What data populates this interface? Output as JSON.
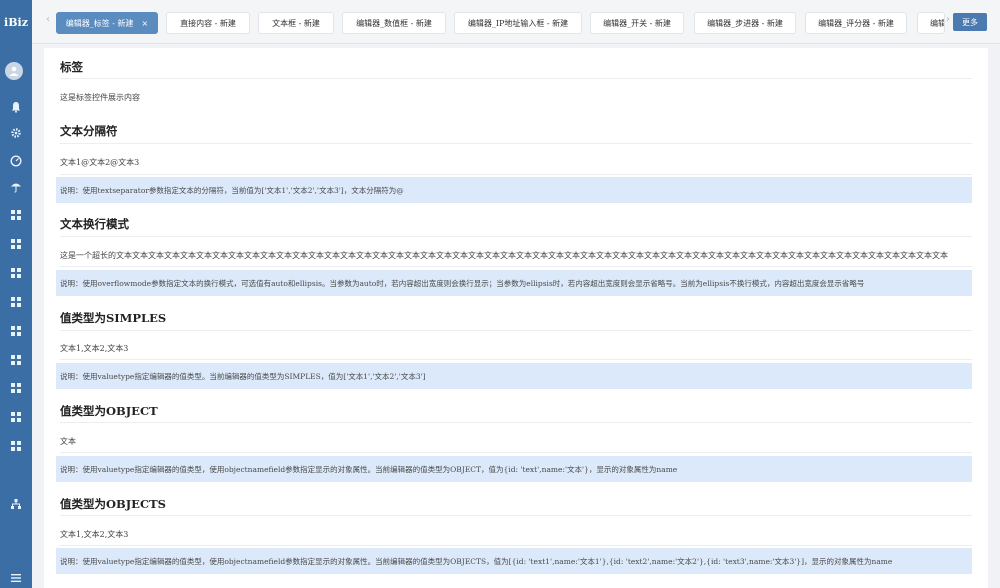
{
  "app": {
    "logo": "iBiz"
  },
  "sidebar": {
    "icons": [
      "bell-icon",
      "gear-icon",
      "dashboard-icon",
      "umbrella-icon",
      "grid-icon",
      "grid-icon",
      "grid-icon",
      "grid-icon",
      "grid-icon",
      "grid-icon",
      "grid-icon",
      "grid-icon",
      "grid-icon",
      "org-icon",
      "menu-icon"
    ]
  },
  "tabs": [
    {
      "label": "编辑器_标签 - 新建",
      "active": true
    },
    {
      "label": "直接内容 - 新建"
    },
    {
      "label": "文本框 - 新建"
    },
    {
      "label": "编辑器_数值框 - 新建"
    },
    {
      "label": "编辑器_IP地址输入框 - 新建"
    },
    {
      "label": "编辑器_开关 - 新建"
    },
    {
      "label": "编辑器_步进器 - 新建"
    },
    {
      "label": "编辑器_评分器 - 新建"
    },
    {
      "label": "编辑"
    }
  ],
  "tabbar": {
    "close_glyph": "×",
    "more_label": "更多"
  },
  "sections": [
    {
      "title": "标签",
      "value": "这是标签控件展示内容",
      "note": ""
    },
    {
      "title": "文本分隔符",
      "value": "文本1@文本2@文本3",
      "note": "说明：使用textseparator参数指定文本的分隔符，当前值为['文本1','文本2','文本3']，文本分隔符为@"
    },
    {
      "title": "文本换行模式",
      "value": "这是一个超长的文本文本文本文本文本文本文本文本文本文本文本文本文本文本文本文本文本文本文本文本文本文本文本文本文本文本文本文本文本文本文本文本文本文本文本文本文本文本文本文本文本文本文本文本文本文本文本文本文本文本文本文本",
      "note": "说明：使用overflowmode参数指定文本的换行模式，可选值有auto和ellipsis。当参数为auto时，若内容超出宽度则会换行显示；当参数为ellipsis时，若内容超出宽度则会显示省略号。当前为ellipsis不换行模式，内容超出宽度会显示省略号"
    },
    {
      "title": "值类型为SIMPLES",
      "value": "文本1,文本2,文本3",
      "note": "说明：使用valuetype指定编辑器的值类型。当前编辑器的值类型为SIMPLES，值为['文本1','文本2','文本3']"
    },
    {
      "title": "值类型为OBJECT",
      "value": "文本",
      "note": "说明：使用valuetype指定编辑器的值类型，使用objectnamefield参数指定显示的对象属性。当前编辑器的值类型为OBJECT，值为{id: 'text',name:'文本'}，显示的对象属性为name"
    },
    {
      "title": "值类型为OBJECTS",
      "value": "文本1,文本2,文本3",
      "note": "说明：使用valuetype指定编辑器的值类型，使用objectnamefield参数指定显示的对象属性。当前编辑器的值类型为OBJECTS，值为[{id: 'text1',name:'文本1'},{id: 'text2',name:'文本2'},{id: 'text3',name:'文本3'}]，显示的对象属性为name"
    }
  ],
  "colors": {
    "sidebar": "#3b6ea5",
    "active_tab": "#5b8cbf",
    "note_bg": "#dbe9fa"
  }
}
